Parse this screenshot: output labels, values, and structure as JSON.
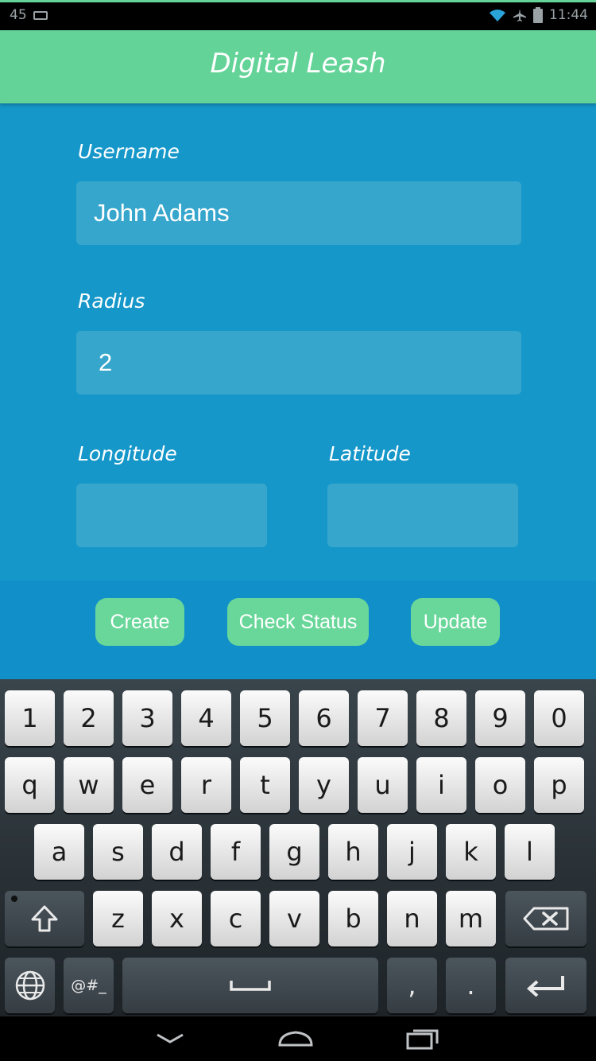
{
  "status_bar": {
    "left_text": "45",
    "time": "11:44",
    "icons": [
      "keyboard-icon",
      "wifi-icon",
      "airplane-icon",
      "battery-icon"
    ]
  },
  "app_bar": {
    "title": "Digital Leash"
  },
  "form": {
    "username_label": "Username",
    "username_value": "John Adams",
    "radius_label": "Radius",
    "radius_value": "2",
    "longitude_label": "Longitude",
    "longitude_value": "",
    "latitude_label": "Latitude",
    "latitude_value": ""
  },
  "buttons": {
    "create": "Create",
    "check_status": "Check Status",
    "update": "Update"
  },
  "keyboard": {
    "row1": [
      "1",
      "2",
      "3",
      "4",
      "5",
      "6",
      "7",
      "8",
      "9",
      "0"
    ],
    "row2": [
      "q",
      "w",
      "e",
      "r",
      "t",
      "y",
      "u",
      "i",
      "o",
      "p"
    ],
    "row3": [
      "a",
      "s",
      "d",
      "f",
      "g",
      "h",
      "j",
      "k",
      "l"
    ],
    "row4": [
      "z",
      "x",
      "c",
      "v",
      "b",
      "n",
      "m"
    ],
    "symbols_label": "@#_",
    "comma": ",",
    "period": "."
  },
  "colors": {
    "accent_green": "#63d397",
    "form_blue": "#1597c9",
    "field_blue": "#37a6cc"
  }
}
